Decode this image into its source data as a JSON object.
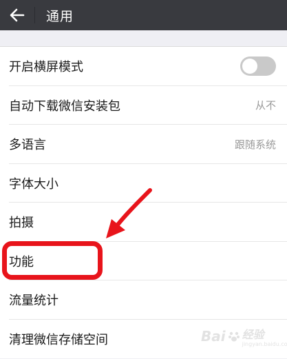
{
  "header": {
    "title": "通用",
    "back_icon": "arrow-left-icon"
  },
  "settings": {
    "items": [
      {
        "label": "开启横屏模式",
        "control": "toggle",
        "toggle_on": false
      },
      {
        "label": "自动下载微信安装包",
        "value": "从不"
      },
      {
        "label": "多语言",
        "value": "跟随系统"
      },
      {
        "label": "字体大小"
      },
      {
        "label": "拍摄"
      },
      {
        "label": "功能"
      },
      {
        "label": "流量统计"
      },
      {
        "label": "清理微信存储空间"
      }
    ]
  },
  "annotation": {
    "highlight_color": "#e8141b"
  },
  "watermark": {
    "brand": "Bai",
    "suffix": "经验",
    "sub": "jingyan.baidu.com"
  }
}
